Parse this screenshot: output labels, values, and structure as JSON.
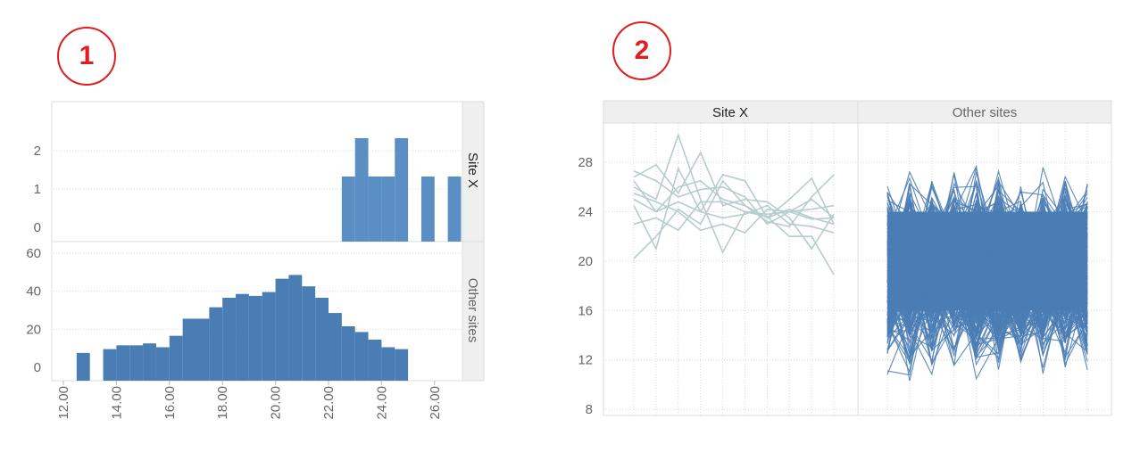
{
  "badges": {
    "first": "1",
    "second": "2"
  },
  "chart_data": [
    {
      "type": "bar",
      "panels": [
        {
          "name": "Site X",
          "y_ticks": [
            "0",
            "1",
            "2"
          ],
          "ylim": [
            0,
            2.5
          ],
          "bins": [
            {
              "x0": 22.5,
              "x1": 23.0,
              "count": 1
            },
            {
              "x0": 23.0,
              "x1": 23.5,
              "count": 2
            },
            {
              "x0": 23.5,
              "x1": 24.0,
              "count": 1
            },
            {
              "x0": 24.0,
              "x1": 24.5,
              "count": 1
            },
            {
              "x0": 24.5,
              "x1": 25.0,
              "count": 2
            },
            {
              "x0": 25.5,
              "x1": 26.0,
              "count": 1
            },
            {
              "x0": 26.5,
              "x1": 27.0,
              "count": 1
            }
          ]
        },
        {
          "name": "Other sites",
          "y_ticks": [
            "0",
            "20",
            "40",
            "60"
          ],
          "ylim": [
            0,
            62
          ],
          "bins": [
            {
              "x0": 12.5,
              "x1": 13.0,
              "count": 1
            },
            {
              "x0": 13.5,
              "x1": 14.0,
              "count": 3
            },
            {
              "x0": 14.0,
              "x1": 14.5,
              "count": 5
            },
            {
              "x0": 14.5,
              "x1": 15.0,
              "count": 5
            },
            {
              "x0": 15.0,
              "x1": 15.5,
              "count": 6
            },
            {
              "x0": 15.5,
              "x1": 16.0,
              "count": 4
            },
            {
              "x0": 16.0,
              "x1": 16.5,
              "count": 10
            },
            {
              "x0": 16.5,
              "x1": 17.0,
              "count": 19
            },
            {
              "x0": 17.0,
              "x1": 17.5,
              "count": 19
            },
            {
              "x0": 17.5,
              "x1": 18.0,
              "count": 25
            },
            {
              "x0": 18.0,
              "x1": 18.5,
              "count": 30
            },
            {
              "x0": 18.5,
              "x1": 19.0,
              "count": 32
            },
            {
              "x0": 19.0,
              "x1": 19.5,
              "count": 31
            },
            {
              "x0": 19.5,
              "x1": 20.0,
              "count": 33
            },
            {
              "x0": 20.0,
              "x1": 20.5,
              "count": 40
            },
            {
              "x0": 20.5,
              "x1": 21.0,
              "count": 42
            },
            {
              "x0": 21.0,
              "x1": 21.5,
              "count": 36
            },
            {
              "x0": 21.5,
              "x1": 22.0,
              "count": 30
            },
            {
              "x0": 22.0,
              "x1": 22.5,
              "count": 22
            },
            {
              "x0": 22.5,
              "x1": 23.0,
              "count": 15
            },
            {
              "x0": 23.0,
              "x1": 23.5,
              "count": 12
            },
            {
              "x0": 23.5,
              "x1": 24.0,
              "count": 8
            },
            {
              "x0": 24.0,
              "x1": 24.5,
              "count": 4
            },
            {
              "x0": 24.5,
              "x1": 25.0,
              "count": 3
            }
          ]
        }
      ],
      "x_ticks": [
        "12.00",
        "14.00",
        "16.00",
        "18.00",
        "20.00",
        "22.00",
        "24.00",
        "26.00"
      ],
      "xlim": [
        11.7,
        28.0
      ],
      "colors": {
        "site_x": "#5b8fc3",
        "other_sites": "#4b7db5"
      },
      "grid": true
    },
    {
      "type": "line",
      "panels": [
        {
          "name": "Site X",
          "x": [
            1,
            2,
            3,
            4,
            5,
            6,
            7,
            8,
            9,
            10
          ],
          "series": [
            {
              "values": [
                20.2,
                22.0,
                24.2,
                23.0,
                26.5,
                24.5,
                23.2,
                22.8,
                25.2,
                27.0
              ]
            },
            {
              "values": [
                26.5,
                24.0,
                24.8,
                24.0,
                23.5,
                23.8,
                24.5,
                23.0,
                22.8,
                22.3
              ]
            },
            {
              "values": [
                25.0,
                24.0,
                26.0,
                26.5,
                25.0,
                24.5,
                23.5,
                24.2,
                23.5,
                23.0
              ]
            },
            {
              "values": [
                27.3,
                26.5,
                25.2,
                25.8,
                26.0,
                25.2,
                23.0,
                24.0,
                25.0,
                23.5
              ]
            },
            {
              "values": [
                26.8,
                27.8,
                25.5,
                28.8,
                24.5,
                25.0,
                24.8,
                23.5,
                21.0,
                23.8
              ]
            },
            {
              "values": [
                26.0,
                25.0,
                30.2,
                25.0,
                20.7,
                24.0,
                23.6,
                22.0,
                22.0,
                18.9
              ]
            },
            {
              "values": [
                23.0,
                23.5,
                22.5,
                24.8,
                24.8,
                24.0,
                23.8,
                24.0,
                24.2,
                24.5
              ]
            },
            {
              "values": [
                24.5,
                21.0,
                27.5,
                24.0,
                27.0,
                26.5,
                23.5,
                25.0,
                26.7,
                23.0
              ]
            },
            {
              "values": [
                25.5,
                24.8,
                24.0,
                22.5,
                23.0,
                22.3,
                24.2,
                24.0,
                23.4,
                23.5
              ]
            }
          ]
        },
        {
          "name": "Other sites",
          "x": [
            1,
            2,
            3,
            4,
            5,
            6,
            7,
            8,
            9,
            10
          ],
          "band": {
            "lower": 16.0,
            "upper": 24.0
          },
          "envelope": {
            "min": 9.5,
            "max": 28.5
          },
          "series_count": 300
        }
      ],
      "y_ticks": [
        "8",
        "12",
        "16",
        "20",
        "24",
        "28"
      ],
      "ylim": [
        7.5,
        31.5
      ],
      "colors": {
        "site_x": "#b7cccc",
        "other_sites": "#4b7db5"
      },
      "grid": true
    }
  ]
}
